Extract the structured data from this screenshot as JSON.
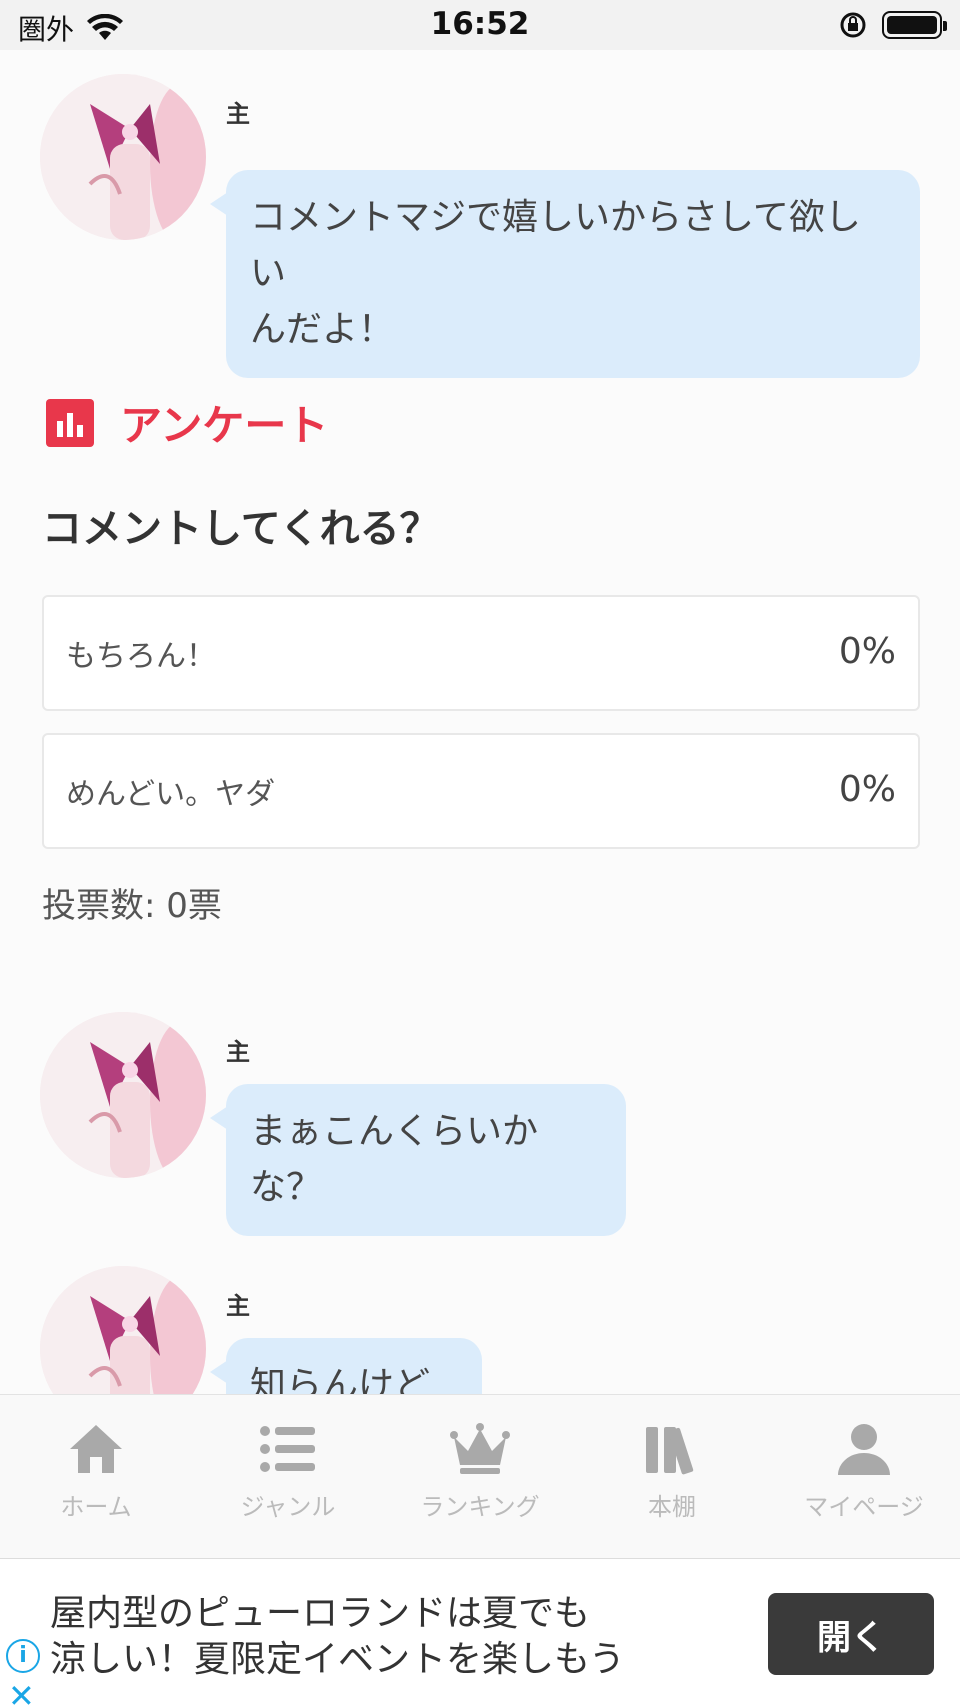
{
  "status_bar": {
    "carrier": "圏外",
    "time": "16:52"
  },
  "messages": [
    {
      "author": "主",
      "text_lines": [
        "コメントマジで嬉しいからさして欲しい",
        "んだよ！"
      ]
    },
    {
      "author": "主",
      "text": "まぁこんくらいかな？"
    },
    {
      "author": "主",
      "text": "知らんけど←"
    }
  ],
  "survey": {
    "title": "アンケート",
    "question": "コメントしてくれる？",
    "options": [
      {
        "label": "もちろん！",
        "percent": "0%"
      },
      {
        "label": "めんどい。ヤダ",
        "percent": "0%"
      }
    ],
    "votes": "投票数: 0票"
  },
  "tabbar": {
    "items": [
      {
        "label": "ホーム",
        "icon": "home-icon"
      },
      {
        "label": "ジャンル",
        "icon": "list-icon"
      },
      {
        "label": "ランキング",
        "icon": "crown-icon"
      },
      {
        "label": "本棚",
        "icon": "bookshelf-icon"
      },
      {
        "label": "マイページ",
        "icon": "user-icon"
      }
    ]
  },
  "ad": {
    "line1": "屋内型のピューロランドは夏でも",
    "line2": "涼しい！夏限定イベントを楽しもう",
    "button": "開く"
  }
}
